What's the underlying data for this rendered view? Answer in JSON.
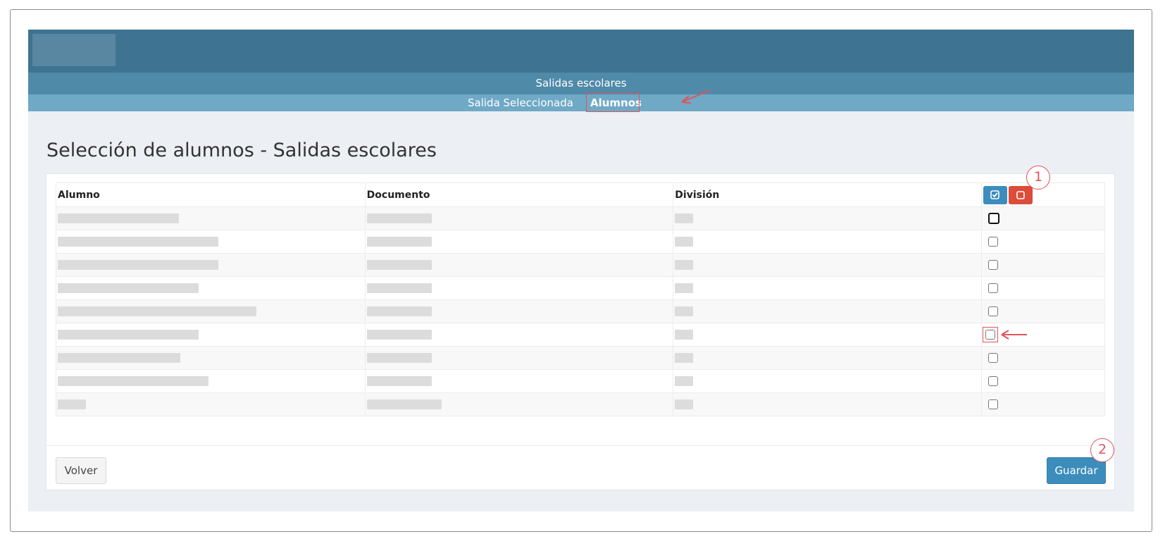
{
  "menu": {
    "section_title": "Salidas escolares",
    "sub_items": [
      "Salida Seleccionada",
      "Alumnos"
    ]
  },
  "page": {
    "title": "Selección de alumnos - Salidas escolares"
  },
  "table": {
    "headers": [
      "Alumno",
      "Documento",
      "División"
    ],
    "rows": [
      {
        "checked": false
      },
      {
        "checked": false
      },
      {
        "checked": false
      },
      {
        "checked": false
      },
      {
        "checked": false
      },
      {
        "checked": false
      },
      {
        "checked": false
      },
      {
        "checked": false
      },
      {
        "checked": false
      }
    ]
  },
  "actions": {
    "back_label": "Volver",
    "save_label": "Guardar"
  },
  "annotations": {
    "step1": "1",
    "step2": "2"
  },
  "icons": {
    "select_all": "check-square-icon",
    "deselect_all": "square-icon"
  },
  "colors": {
    "header": "#3e7391",
    "menu": "#508aa9",
    "submenu": "#6fa9c6",
    "primary": "#3c8dbc",
    "danger": "#dd4b39",
    "annotation": "#e0535a"
  }
}
